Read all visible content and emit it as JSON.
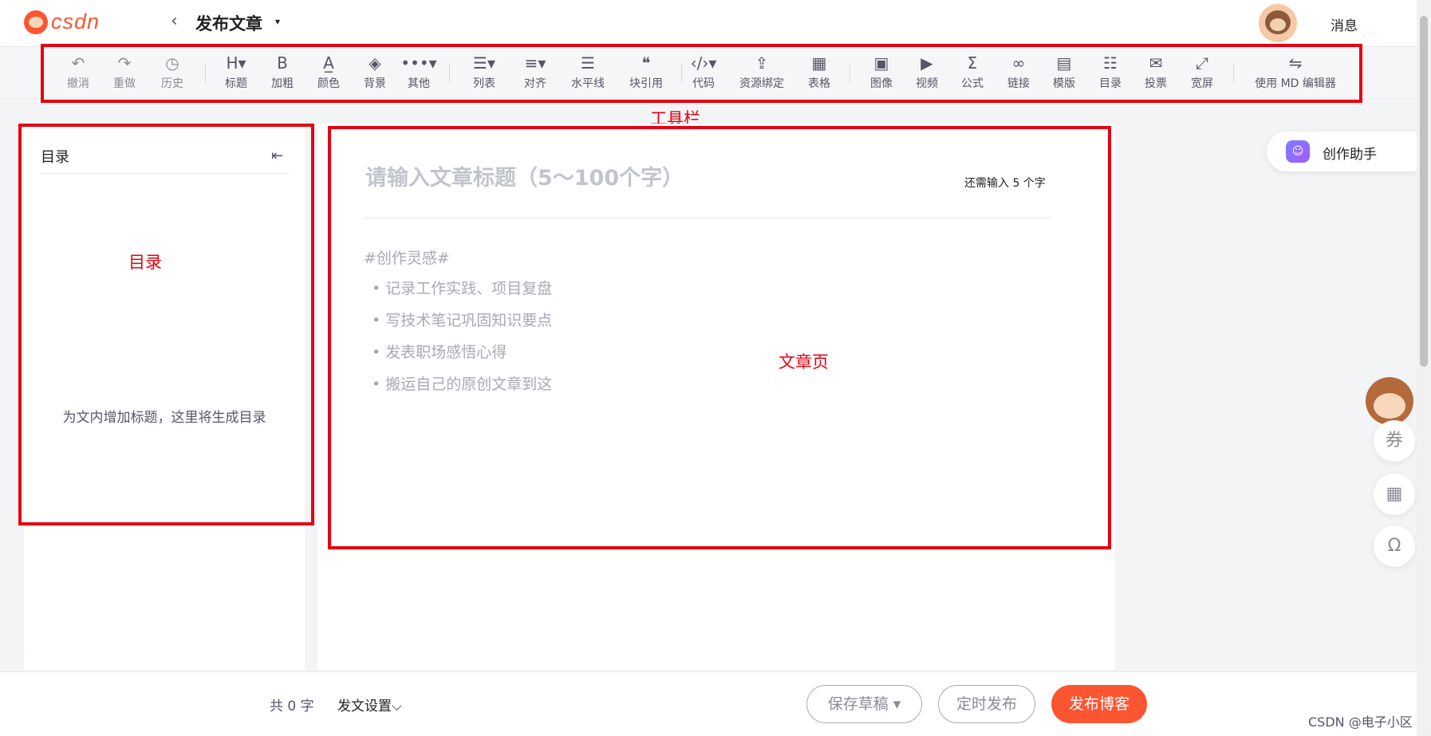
{
  "header": {
    "logo_text": "csdn",
    "back_icon": "chevron-left-icon",
    "title": "发布文章",
    "title_caret": "▾",
    "messages": "消息"
  },
  "toolbar": {
    "items": [
      {
        "label": "撤消",
        "glyph": "↶",
        "icon": "undo-icon",
        "enabled": false
      },
      {
        "label": "重做",
        "glyph": "↷",
        "icon": "redo-icon",
        "enabled": false
      },
      {
        "label": "历史",
        "glyph": "◷",
        "icon": "history-icon",
        "enabled": false
      },
      {
        "label": "标题",
        "glyph": "H▾",
        "icon": "heading-icon",
        "enabled": true
      },
      {
        "label": "加粗",
        "glyph": "B",
        "icon": "bold-icon",
        "enabled": true
      },
      {
        "label": "颜色",
        "glyph": "A̲",
        "icon": "font-color-icon",
        "enabled": true
      },
      {
        "label": "背景",
        "glyph": "◈",
        "icon": "paint-bucket-icon",
        "enabled": true
      },
      {
        "label": "其他",
        "glyph": "•••▾",
        "icon": "more-icon",
        "enabled": true
      },
      {
        "label": "列表",
        "glyph": "☰▾",
        "icon": "list-icon",
        "enabled": true
      },
      {
        "label": "对齐",
        "glyph": "≡▾",
        "icon": "align-icon",
        "enabled": true
      },
      {
        "label": "水平线",
        "glyph": "☰",
        "icon": "horizontal-rule-icon",
        "enabled": true
      },
      {
        "label": "块引用",
        "glyph": "❝",
        "icon": "blockquote-icon",
        "enabled": true
      },
      {
        "label": "代码",
        "glyph": "‹/›▾",
        "icon": "code-icon",
        "enabled": true
      },
      {
        "label": "资源绑定",
        "glyph": "⇪",
        "icon": "resource-bind-icon",
        "enabled": true
      },
      {
        "label": "表格",
        "glyph": "▦",
        "icon": "table-icon",
        "enabled": true
      },
      {
        "label": "图像",
        "glyph": "▣",
        "icon": "image-icon",
        "enabled": true
      },
      {
        "label": "视频",
        "glyph": "▶",
        "icon": "video-icon",
        "enabled": true
      },
      {
        "label": "公式",
        "glyph": "Σ",
        "icon": "formula-icon",
        "enabled": true
      },
      {
        "label": "链接",
        "glyph": "∞",
        "icon": "link-icon",
        "enabled": true
      },
      {
        "label": "模版",
        "glyph": "▤",
        "icon": "template-icon",
        "enabled": true
      },
      {
        "label": "目录",
        "glyph": "☷",
        "icon": "toc-icon",
        "enabled": true
      },
      {
        "label": "投票",
        "glyph": "✉",
        "icon": "vote-icon",
        "enabled": true
      },
      {
        "label": "宽屏",
        "glyph": "⤢",
        "icon": "fullscreen-icon",
        "enabled": true
      },
      {
        "label": "使用 MD 编辑器",
        "glyph": "⇋",
        "icon": "switch-editor-icon",
        "enabled": true
      }
    ]
  },
  "annotations": {
    "toolbar": "工具栏",
    "toc": "目录",
    "article": "文章页"
  },
  "toc": {
    "title": "目录",
    "collapse_icon": "collapse-icon",
    "collapse_glyph": "⇤",
    "empty_text": "为文内增加标题，这里将生成目录"
  },
  "editor": {
    "title_placeholder": "请输入文章标题（5～100个字）",
    "title_value": "",
    "remaining": "还需输入 5 个字",
    "heading": "#创作灵感#",
    "bullets": [
      "记录工作实践、项目复盘",
      "写技术笔记巩固知识要点",
      "发表职场感悟心得",
      "搬运自己的原创文章到这"
    ]
  },
  "assistant": {
    "label": "创作助手",
    "icon": "robot-icon",
    "glyph": "☺"
  },
  "side_buttons": [
    {
      "name": "coupon-icon",
      "glyph": "券"
    },
    {
      "name": "qr-code-icon",
      "glyph": "▦"
    },
    {
      "name": "headset-icon",
      "glyph": "Ω"
    }
  ],
  "footer": {
    "word_count": "共 0 字",
    "publish_settings": "发文设置",
    "publish_settings_caret": "⌵",
    "save_draft": "保存草稿 ▾",
    "scheduled": "定时发布",
    "publish": "发布博客",
    "watermark": "CSDN @电子小区"
  },
  "colors": {
    "brand": "#fc5531",
    "annotation": "#e60012",
    "page_bg": "#f3f4f6"
  }
}
